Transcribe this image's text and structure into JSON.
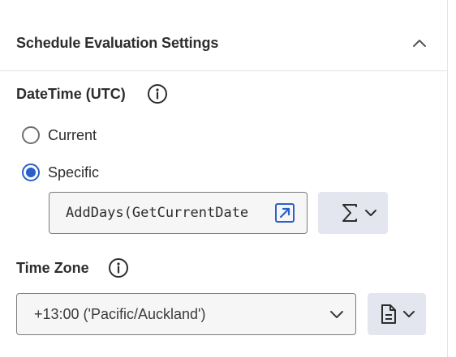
{
  "section": {
    "title": "Schedule Evaluation Settings",
    "collapse_icon": "chevron-up-icon"
  },
  "datetime": {
    "label": "DateTime (UTC)",
    "info_icon": "info-icon",
    "options": [
      {
        "label": "Current",
        "selected": false
      },
      {
        "label": "Specific",
        "selected": true
      }
    ],
    "expression_value": "AddDays(GetCurrentDate",
    "expand_icon": "open-in-new-icon",
    "sigma_icon": "sigma-icon"
  },
  "timezone": {
    "label": "Time Zone",
    "info_icon": "info-icon",
    "selected_value": "+13:00 ('Pacific/Auckland')",
    "dropdown_icon": "chevron-down-icon",
    "doc_icon": "document-icon"
  },
  "colors": {
    "accent": "#2a60c8",
    "button_bg": "#e3e6ee",
    "input_bg": "#f6f6f7"
  }
}
